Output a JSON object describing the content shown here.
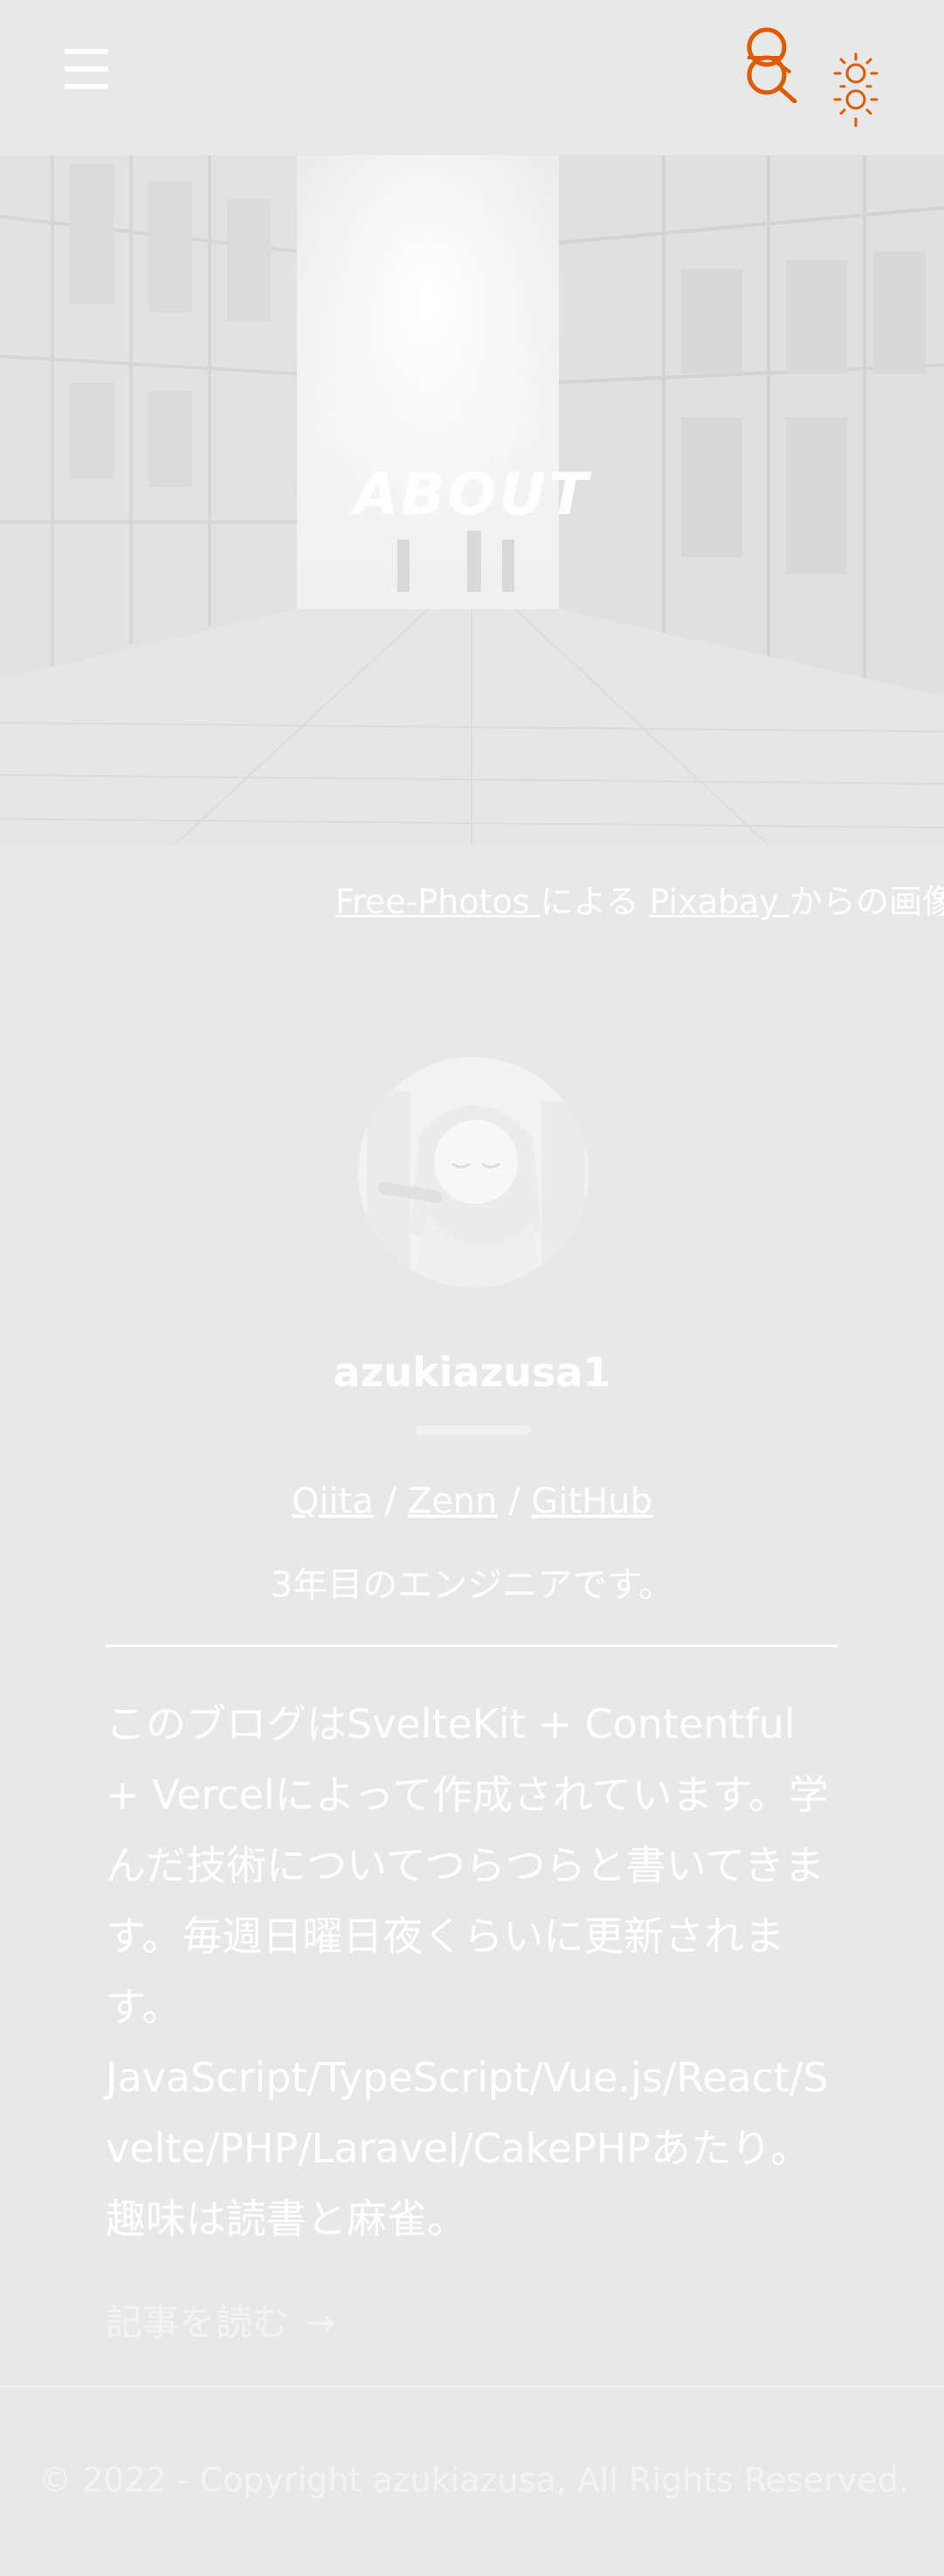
{
  "header": {
    "menu_icon": "hamburger-icon",
    "search_icon": "search-icon",
    "theme_icon": "sun-icon",
    "accent_color": "#e05a00"
  },
  "hero": {
    "title": "ABOUT"
  },
  "credit": {
    "author_link": "Free-Photos ",
    "by_text": "による",
    "site_link": "Pixabay ",
    "from_text": "からの画像"
  },
  "profile": {
    "username": "azukiazusa1",
    "links": [
      {
        "label": "Qiita"
      },
      {
        "label": "Zenn"
      },
      {
        "label": "GitHub"
      }
    ],
    "separator": "/",
    "tagline": "3年目のエンジニアです。"
  },
  "bio": {
    "paragraph1": "このブログはSvelteKit + Contentful + Vercelによって作成されています。学んだ技術についてつらつらと書いてきます。毎週日曜日夜くらいに更新されます。",
    "paragraph2": "JavaScript/TypeScript/Vue.js/React/Svelte/PHP/Laravel/CakePHPあたり。",
    "paragraph3": "趣味は読書と麻雀。"
  },
  "read_more": {
    "label": "記事を読む",
    "arrow": "→"
  },
  "footer": {
    "copyright": "© 2022 - Copyright azukiazusa, All Rights Reserved."
  }
}
